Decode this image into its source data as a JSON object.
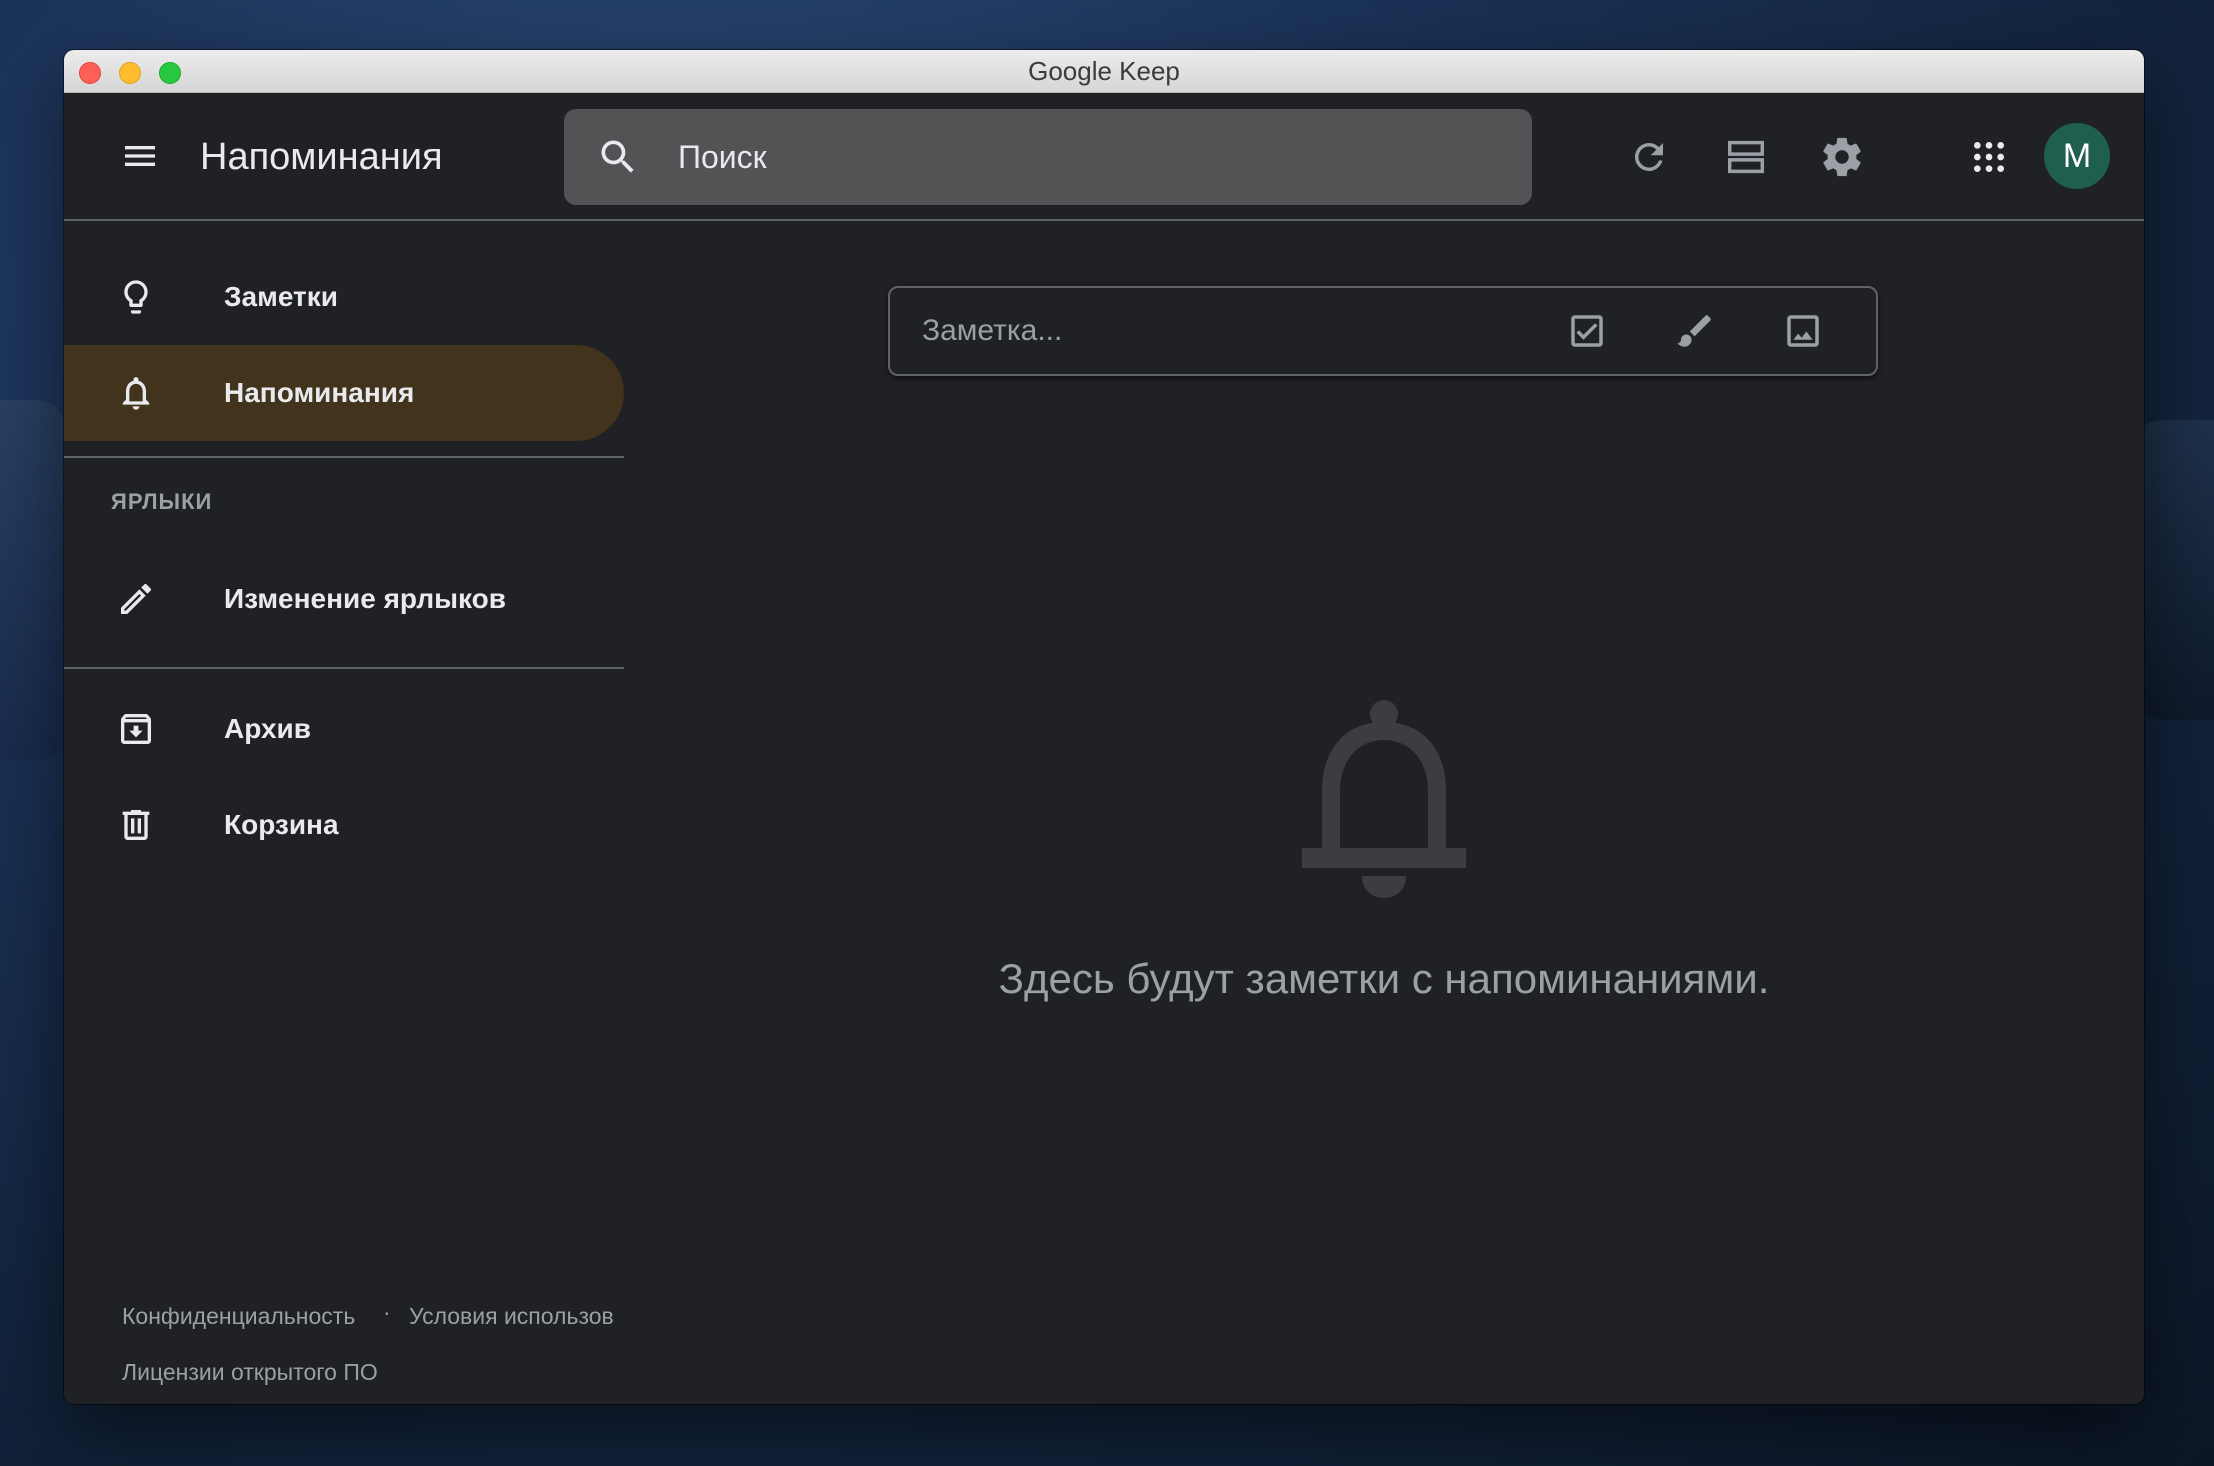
{
  "window": {
    "title": "Google Keep"
  },
  "header": {
    "menu_icon": "menu-icon",
    "title": "Напоминания",
    "search": {
      "icon": "search-icon",
      "placeholder": "Поиск"
    },
    "actions": [
      {
        "name": "refresh-icon"
      },
      {
        "name": "list-view-icon"
      },
      {
        "name": "settings-icon"
      },
      {
        "name": "apps-grid-icon"
      }
    ],
    "avatar_initial": "M",
    "avatar_color": "#1e5f4f"
  },
  "sidebar": {
    "items": [
      {
        "label": "Заметки",
        "icon": "lightbulb-icon",
        "active": false
      },
      {
        "label": "Напоминания",
        "icon": "bell-icon",
        "active": true
      }
    ],
    "labels_section": {
      "heading": "ЯРЛЫКИ",
      "edit_label": "Изменение ярлыков",
      "edit_icon": "pencil-icon"
    },
    "bottom_items": [
      {
        "label": "Архив",
        "icon": "archive-icon"
      },
      {
        "label": "Корзина",
        "icon": "trash-icon"
      }
    ],
    "footer": {
      "privacy": "Конфиденциальность",
      "separator": "·",
      "terms": "Условия использов",
      "licenses": "Лицензии открытого ПО"
    }
  },
  "main": {
    "take_note": {
      "placeholder": "Заметка...",
      "tools": [
        "checkbox-icon",
        "brush-icon",
        "image-icon"
      ]
    },
    "empty_state": {
      "icon": "bell-icon",
      "text": "Здесь будут заметки с напоминаниями."
    }
  },
  "colors": {
    "background": "#202124",
    "active_item": "#41331c",
    "search_bg": "#525355",
    "text_primary": "#e8eaed",
    "text_secondary": "#9aa0a6"
  }
}
